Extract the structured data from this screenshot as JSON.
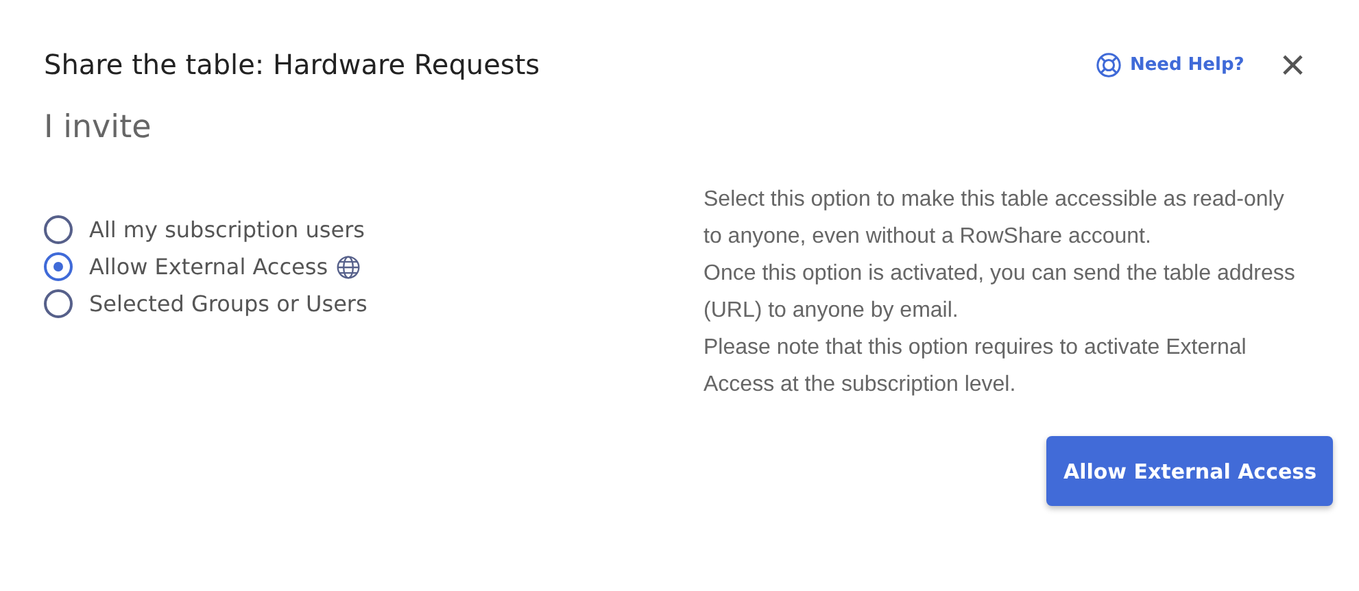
{
  "dialog": {
    "title": "Share the table: Hardware Requests",
    "help_link": "Need Help?",
    "close": "×"
  },
  "section_title": "I invite",
  "options": [
    {
      "label": "All my subscription users",
      "selected": false,
      "globe": false
    },
    {
      "label": "Allow External Access",
      "selected": true,
      "globe": true
    },
    {
      "label": "Selected Groups or Users",
      "selected": false,
      "globe": false
    }
  ],
  "description": [
    "Select this option to make this table accessible as read-only to anyone, even without a RowShare account.",
    "Once this option is activated, you can send the table address (URL) to anyone by email.",
    "Please note that this option requires to activate External Access at the subscription level."
  ],
  "primary_button": "Allow External Access"
}
